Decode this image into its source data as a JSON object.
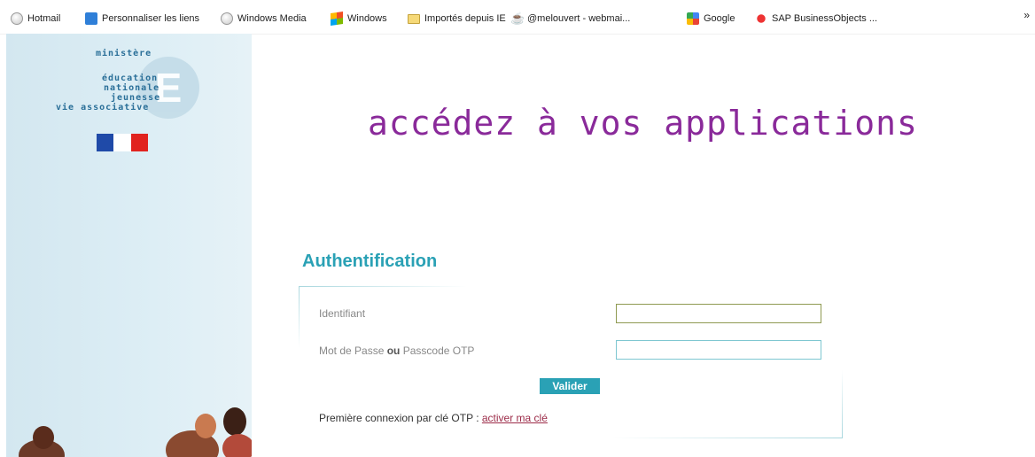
{
  "bookmarks": [
    {
      "label": "Hotmail",
      "icon": "globe-icon"
    },
    {
      "label": "Personnaliser les liens",
      "icon": "ie-page-icon"
    },
    {
      "label": "Windows Media",
      "icon": "globe-icon"
    },
    {
      "label": "Windows",
      "icon": "windows-logo-icon"
    },
    {
      "label": "Importés depuis IE",
      "icon": "folder-icon"
    },
    {
      "label": "@melouvert - webmai...",
      "icon": "java-cup-icon"
    },
    {
      "label": "Google",
      "icon": "google-icon"
    },
    {
      "label": "SAP BusinessObjects ...",
      "icon": "sap-icon"
    }
  ],
  "overflow": "»",
  "logo": {
    "lines": [
      "ministère",
      "éducation",
      "nationale",
      "jeunesse",
      "vie associative"
    ],
    "letter": "E",
    "flag_colors": [
      "#1f4aa8",
      "#ffffff",
      "#e1231e"
    ]
  },
  "headline": "accédez à vos applications",
  "auth": {
    "title": "Authentification",
    "identifiant_label": "Identifiant",
    "password_label_part1": "Mot de Passe ",
    "password_label_bold": "ou",
    "password_label_part2": " Passcode OTP",
    "identifiant_value": "",
    "password_value": "",
    "submit_label": "Valider",
    "otp_text": "Première connexion par clé OTP : ",
    "otp_link": "activer ma clé"
  },
  "colors": {
    "headline": "#8a2a9a",
    "accent": "#2aa1b5",
    "link": "#9c2b48"
  }
}
